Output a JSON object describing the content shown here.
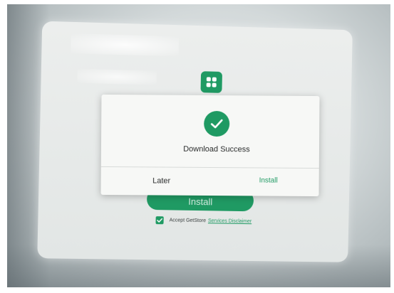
{
  "colors": {
    "accent": "#1f9a63",
    "dialog_bg": "#f7f8f6",
    "screen_bg": "#e6e9e8",
    "text": "#2a2c2c"
  },
  "app": {
    "logo_icon": "app-grid-icon"
  },
  "background": {
    "install_label": "Install",
    "accept_checked": true,
    "accept_text": "Accept GetStore",
    "disclaimer_link": "Services Disclaimer"
  },
  "dialog": {
    "icon": "checkmark-circle-icon",
    "title": "Download Success",
    "later_label": "Later",
    "install_label": "Install"
  }
}
